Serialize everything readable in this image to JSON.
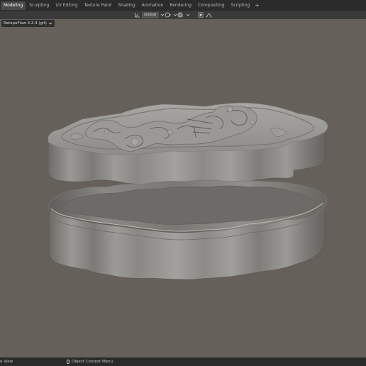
{
  "tabs": [
    {
      "label": "Modeling",
      "active": true
    },
    {
      "label": "Sculpting"
    },
    {
      "label": "UV Editing"
    },
    {
      "label": "Texture Paint"
    },
    {
      "label": "Shading"
    },
    {
      "label": "Animation"
    },
    {
      "label": "Rendering"
    },
    {
      "label": "Compositing"
    },
    {
      "label": "Scripting"
    }
  ],
  "add_tab_glyph": "+",
  "header": {
    "transform_orientation": "Global",
    "icons": [
      "transform-pivot-icon",
      "snap-icon",
      "proportional-edit-icon",
      "falloff-icon"
    ]
  },
  "addon": {
    "label": "RetopoFlow 3.2.4 (git)"
  },
  "statusbar": {
    "left_text": "e View",
    "right_text": "Object Context Menu"
  },
  "colors": {
    "topbar": "#2b2b2b",
    "active_tab": "#4a4a4a",
    "header": "#3a3a3a",
    "viewport": "#656059",
    "statusbar": "#2a2a2a",
    "model_base": "#8f8d88"
  }
}
